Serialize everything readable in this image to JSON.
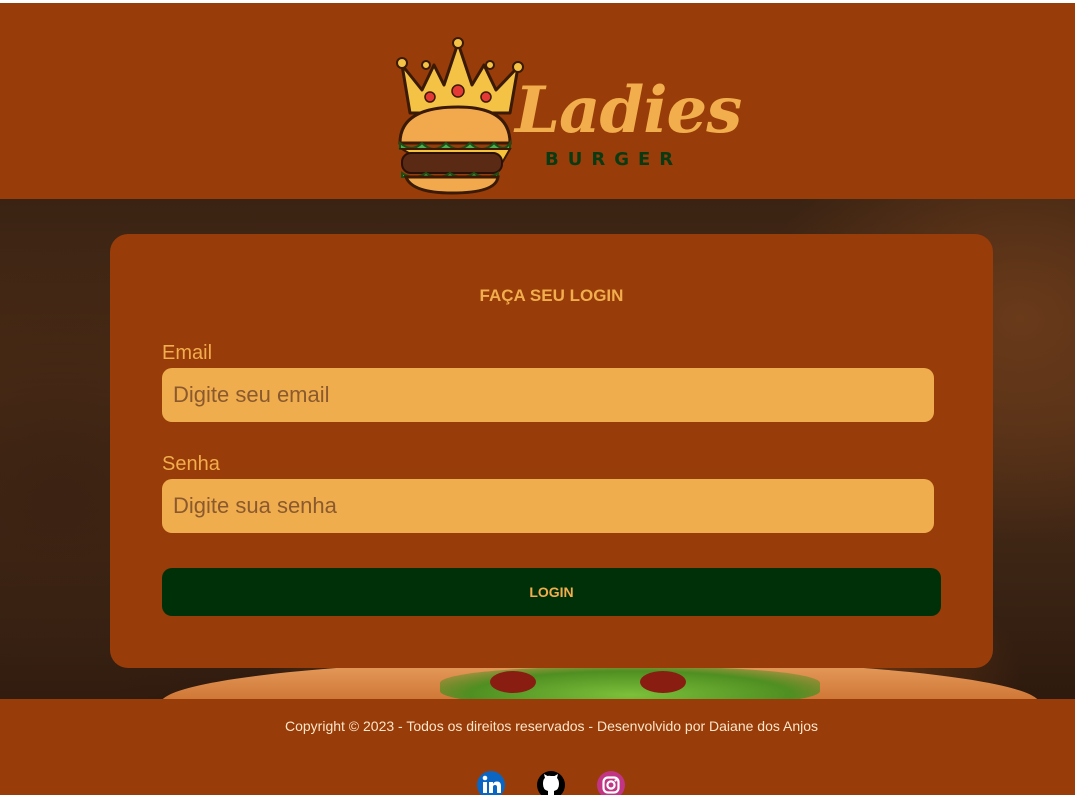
{
  "header": {
    "logo_word": "Ladies",
    "logo_sub": "BURGER"
  },
  "login_form": {
    "title": "FAÇA SEU LOGIN",
    "email_label": "Email",
    "email_placeholder": "Digite seu email",
    "email_value": "",
    "password_label": "Senha",
    "password_placeholder": "Digite sua senha",
    "password_value": "",
    "submit_label": "LOGIN"
  },
  "footer": {
    "copyright": "Copyright © 2023 - Todos os direitos reservados - Desenvolvido por Daiane dos Anjos",
    "social": [
      {
        "icon": "linkedin-icon",
        "color": "#0a66c2"
      },
      {
        "icon": "github-icon",
        "color": "#000000"
      },
      {
        "icon": "instagram-icon",
        "color": "#c13584"
      }
    ]
  },
  "colors": {
    "brand_brown": "#983c09",
    "accent_orange": "#f2ad4c",
    "input_bg": "#f0ad4e",
    "button_green": "#003008"
  }
}
